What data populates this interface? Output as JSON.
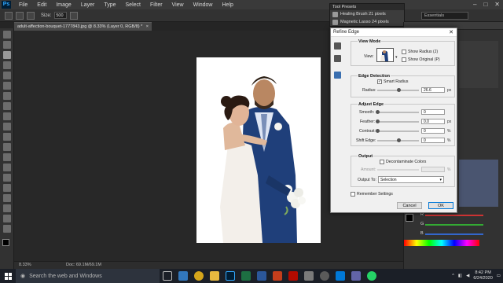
{
  "menubar": {
    "app_logo": "Ps",
    "items": [
      "File",
      "Edit",
      "Image",
      "Layer",
      "Type",
      "Select",
      "Filter",
      "View",
      "Window",
      "Help"
    ],
    "window_controls": [
      "–",
      "□",
      "✕"
    ]
  },
  "options_bar": {
    "size_label": "Size:",
    "size_value": "500",
    "workspace": "Essentials"
  },
  "tool_presets": {
    "title": "Tool Presets",
    "items": [
      "Healing Brush 21 pixels",
      "Magnetic Lasso 24 pixels"
    ]
  },
  "document": {
    "tab_title": "adult-affection-bouquet-1777843.jpg @ 8.33% (Layer 0, RGB/8) *",
    "tab_close": "×",
    "zoom": "8.33%",
    "doc_size": "Doc: 69.1M/69.1M"
  },
  "refine_edge": {
    "title": "Refine Edge",
    "close": "✕",
    "view_mode": {
      "title": "View Mode",
      "view_label": "View:",
      "show_radius": "Show Radius (J)",
      "show_original": "Show Original (P)"
    },
    "edge_detection": {
      "title": "Edge Detection",
      "smart_radius": "Smart Radius",
      "smart_radius_checked": true,
      "radius_label": "Radius:",
      "radius_value": "26.6",
      "radius_unit": "px"
    },
    "adjust_edge": {
      "title": "Adjust Edge",
      "smooth_label": "Smooth:",
      "smooth_value": "0",
      "feather_label": "Feather:",
      "feather_value": "0.0",
      "feather_unit": "px",
      "contrast_label": "Contrast:",
      "contrast_value": "0",
      "contrast_unit": "%",
      "shift_label": "Shift Edge:",
      "shift_value": "0",
      "shift_unit": "%"
    },
    "output": {
      "title": "Output",
      "decontaminate": "Decontaminate Colors",
      "amount_label": "Amount:",
      "amount_unit": "%",
      "output_to_label": "Output To:",
      "output_to_value": "Selection"
    },
    "remember_settings": "Remember Settings",
    "cancel": "Cancel",
    "ok": "OK"
  },
  "color_panel": {
    "r": "R",
    "g": "G",
    "b": "B"
  },
  "taskbar": {
    "search_placeholder": "Search the web and Windows",
    "time": "8:42 PM",
    "date": "6/24/2020"
  },
  "colors": {
    "accent": "#31a8ff",
    "dialog_bg": "#f0f0f0",
    "taskbar_bg": "#1b1f27"
  }
}
